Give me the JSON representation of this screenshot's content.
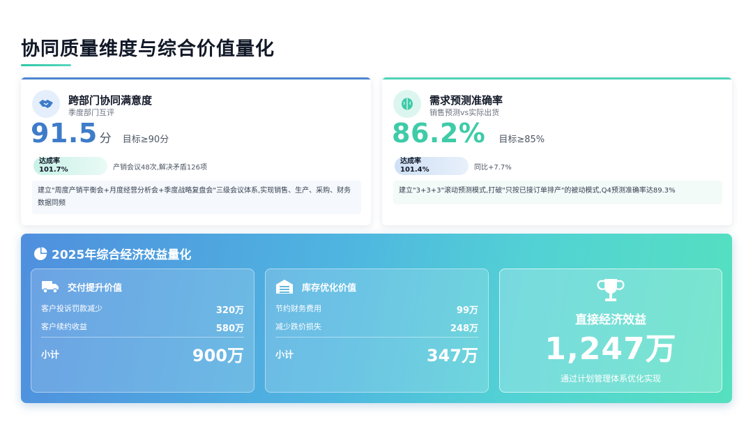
{
  "page": {
    "title": "协同质量维度与综合价值量化"
  },
  "cards": [
    {
      "icon": "handshake-icon",
      "title": "跨部门协同满意度",
      "subtitle": "季度部门互评",
      "value": "91.5",
      "unit": "分",
      "target": "目标≥90分",
      "rate_label": "达成率",
      "rate_value": "101.7%",
      "note": "产销会议48次,解决矛盾126项",
      "description": "建立\"周度产销平衡会+月度经营分析会+季度战略复盘会\"三级会议体系,实现销售、生产、采购、财务数据同频"
    },
    {
      "icon": "brain-icon",
      "title": "需求预测准确率",
      "subtitle": "销售预测vs实际出货",
      "value": "86.2%",
      "unit": "",
      "target": "目标≥85%",
      "rate_label": "达成率",
      "rate_value": "101.4%",
      "note": "同比+7.7%",
      "description": "建立\"3+3+3\"滚动预测模式,打破\"只按已接订单排产\"的被动模式,Q4预测准确率达89.3%"
    }
  ],
  "banner": {
    "title": "2025年综合经济效益量化",
    "icon": "pie-chart-icon",
    "panels": [
      {
        "icon": "truck-icon",
        "title": "交付提升价值",
        "rows": [
          {
            "label": "客户投诉罚款减少",
            "value": "320万"
          },
          {
            "label": "客户续约收益",
            "value": "580万"
          }
        ],
        "subtotal_label": "小计",
        "subtotal_value": "900万"
      },
      {
        "icon": "warehouse-icon",
        "title": "库存优化价值",
        "rows": [
          {
            "label": "节约财务费用",
            "value": "99万"
          },
          {
            "label": "减少跌价损失",
            "value": "248万"
          }
        ],
        "subtotal_label": "小计",
        "subtotal_value": "347万"
      }
    ],
    "highlight": {
      "icon": "trophy-icon",
      "label": "直接经济效益",
      "value": "1,247万",
      "note": "通过计划管理体系优化实现"
    }
  },
  "colors": {
    "blue_accent": "#3e7cc9",
    "green_accent": "#3ecba8",
    "banner_start": "#4f8fde",
    "banner_end": "#55e0bf"
  }
}
